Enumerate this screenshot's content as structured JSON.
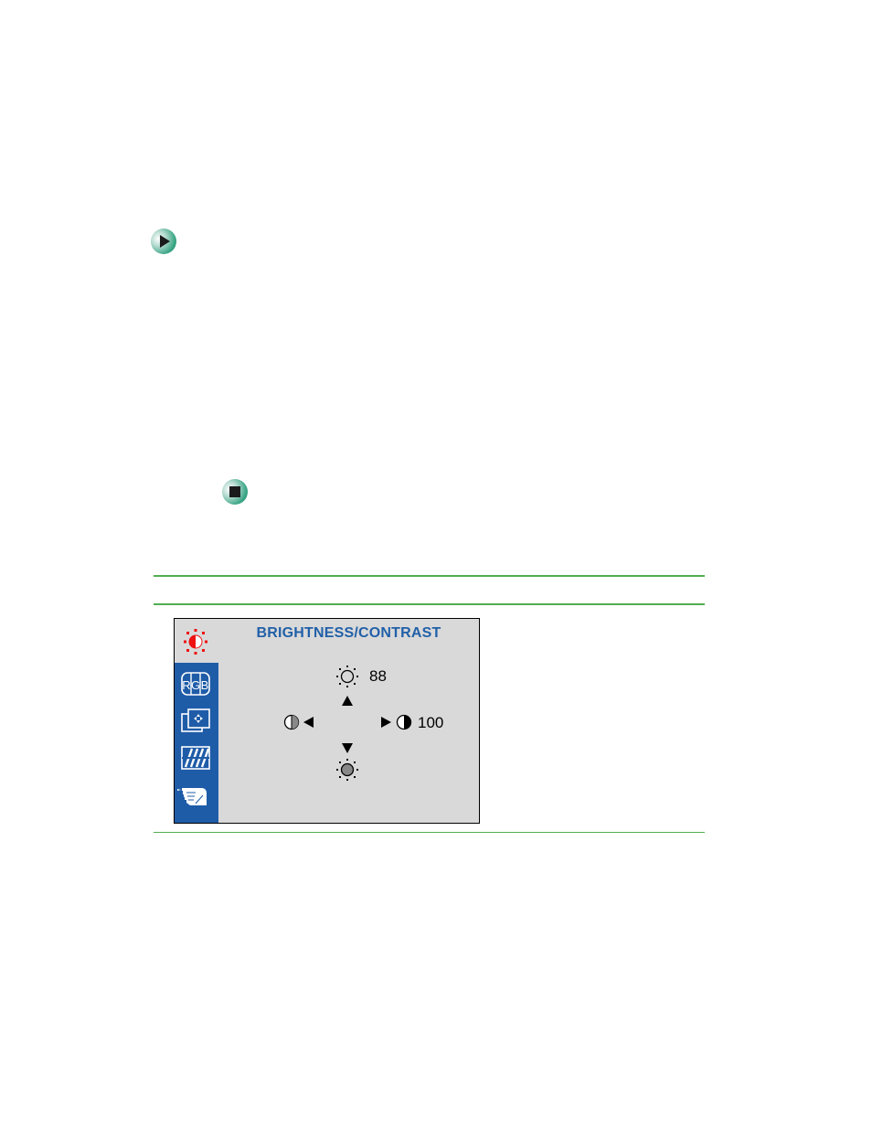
{
  "document": {
    "step_start_icon": "play-arrow-icon",
    "step_end_icon": "stop-square-icon"
  },
  "osd_menu": {
    "title": "BRIGHTNESS/CONTRAST",
    "sidebar": [
      {
        "icon": "brightness-contrast-icon",
        "active": true
      },
      {
        "icon": "rgb-icon",
        "active": false
      },
      {
        "icon": "position-icon",
        "active": false
      },
      {
        "icon": "degauss-icon",
        "active": false
      },
      {
        "icon": "hand-setup-icon",
        "active": false
      }
    ],
    "brightness_value": "88",
    "contrast_value": "100"
  },
  "colors": {
    "accent_green": "#52ae52",
    "osd_blue": "#1f5ca8",
    "osd_title": "#2160a8",
    "osd_bg": "#d9d9d9",
    "active_icon_red": "#ee1111"
  }
}
